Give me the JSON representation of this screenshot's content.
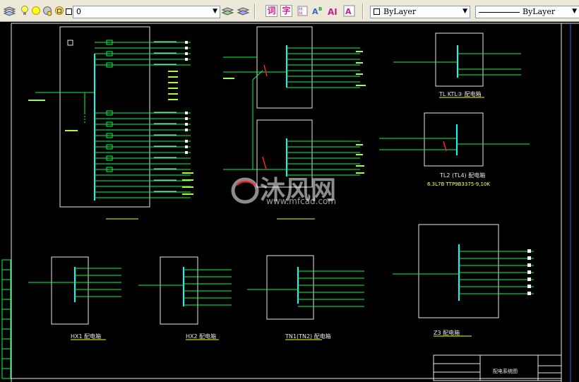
{
  "toolbar": {
    "layer_value": "0",
    "color_value": "ByLayer",
    "linetype_value": "ByLayer",
    "icons": [
      "layer-properties-icon",
      "bulb-icon",
      "sun-icon",
      "freeze-icon",
      "lock-icon",
      "color-square-icon",
      "layer-previous-icon",
      "make-current-icon",
      "text-style-icon",
      "dim-style-icon",
      "table-style-icon",
      "multileader-icon",
      "ai-icon",
      "text-edit-icon"
    ],
    "text_buttons": {
      "word": "词",
      "char": "字"
    }
  },
  "watermark": {
    "brand": "沐风网",
    "url": "www.mfcad.com"
  },
  "drawing": {
    "captions": {
      "tl_kt3": "TL KTL③ 配电箱",
      "tl_kt4": "TL2 (TL4) 配电箱",
      "tl_kt4_sub": "6.3L7B   TTP9B3375-9,10K",
      "hx1": "HX1 配电箱",
      "hx2": "HX2 配电箱",
      "tn1": "TN1(TN2) 配电箱",
      "z3": "Z3 配电箱",
      "main": "配电系统图"
    },
    "colors": {
      "line": "#00ff40",
      "box": "#e8e8e8",
      "cyan": "#00ffff",
      "red": "#ff2020",
      "yellow": "#ffff00",
      "blue": "#4060ff"
    }
  }
}
